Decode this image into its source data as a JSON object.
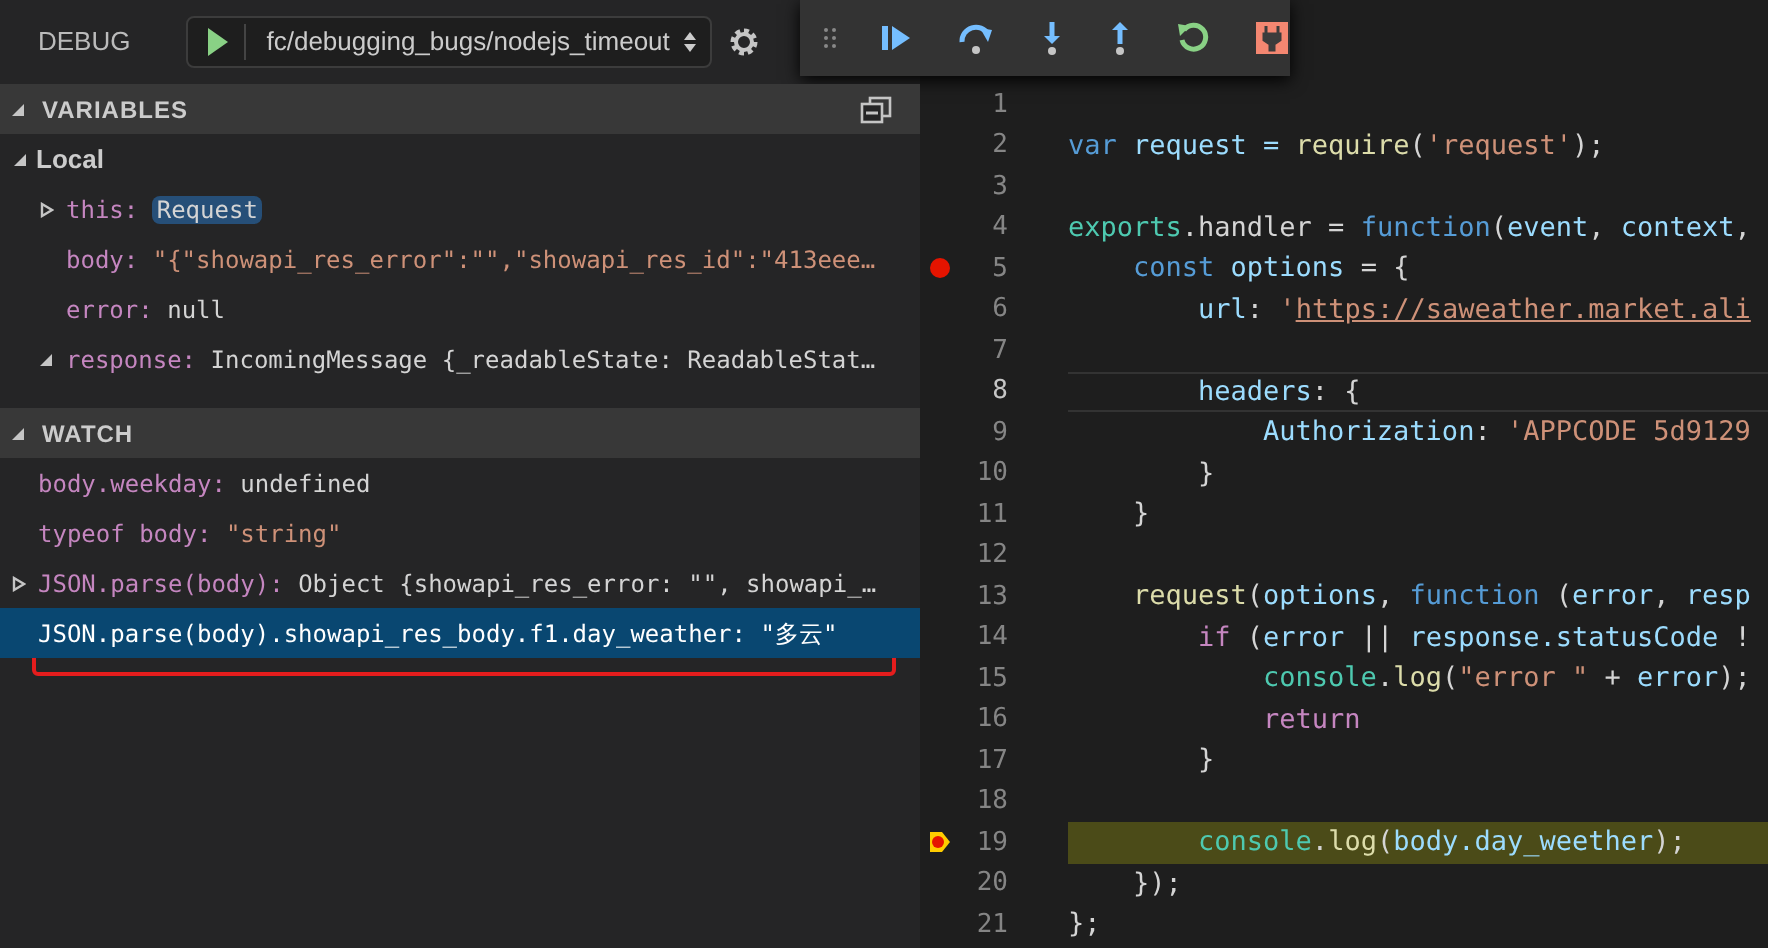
{
  "header": {
    "title": "DEBUG",
    "configuration": "fc/debugging_bugs/nodejs_timeout"
  },
  "toolbar": [
    {
      "kind": "continue"
    },
    {
      "kind": "step-over"
    },
    {
      "kind": "step-into"
    },
    {
      "kind": "step-out"
    },
    {
      "kind": "restart"
    },
    {
      "kind": "disconnect"
    }
  ],
  "variables": {
    "title": "VARIABLES",
    "expanded": true,
    "scopes": [
      {
        "name": "Local",
        "expanded": true,
        "children": [
          {
            "kind": "node",
            "expanded": false,
            "name": "this:",
            "value": {
              "text": "Request",
              "kind": "highlighted"
            }
          },
          {
            "kind": "leaf",
            "name": "body:",
            "value": {
              "text": "\"{\"showapi_res_error\":\"\",\"showapi_res_id\":\"413eee…",
              "kind": "string"
            }
          },
          {
            "kind": "leaf",
            "name": "error:",
            "value": {
              "text": "null",
              "kind": "plain"
            }
          },
          {
            "kind": "node",
            "expanded": true,
            "name": "response:",
            "value": {
              "text": "IncomingMessage {_readableState: ReadableStat…",
              "kind": "plain"
            }
          }
        ]
      }
    ]
  },
  "watch": {
    "title": "WATCH",
    "expanded": true,
    "items": [
      {
        "kind": "leaf",
        "expression": "body.weekday:",
        "value": {
          "text": "undefined",
          "kind": "plain"
        },
        "selected": false,
        "outlined": false
      },
      {
        "kind": "leaf",
        "expression": "typeof body:",
        "value": {
          "text": "\"string\"",
          "kind": "string"
        },
        "selected": false,
        "outlined": false
      },
      {
        "kind": "node",
        "expanded": false,
        "expression": "JSON.parse(body):",
        "value": {
          "text": "Object {showapi_res_error: \"\", showapi_…",
          "kind": "plain"
        },
        "selected": false,
        "outlined": false
      },
      {
        "kind": "leaf",
        "expression": "JSON.parse(body).showapi_res_body.f1.day_weather:",
        "value": {
          "text": "\"多云\"",
          "kind": "plain"
        },
        "selected": true,
        "outlined": true
      }
    ]
  },
  "editor": {
    "lines": [
      {
        "number": "1",
        "breakpoint": false,
        "paused": false,
        "focused": false
      },
      {
        "number": "2",
        "breakpoint": false,
        "paused": false,
        "focused": false,
        "tokens": [
          {
            "text": "var",
            "kind": "keyword"
          },
          {
            "text": " request = ",
            "kind": "variable"
          },
          {
            "text": "require",
            "kind": "function"
          },
          {
            "text": "(",
            "kind": "plain"
          },
          {
            "text": "'request'",
            "kind": "string"
          },
          {
            "text": ");",
            "kind": "plain"
          }
        ]
      },
      {
        "number": "3",
        "breakpoint": false,
        "paused": false,
        "focused": false
      },
      {
        "number": "4",
        "breakpoint": false,
        "paused": false,
        "focused": false,
        "tokens": [
          {
            "text": "exports",
            "kind": "type"
          },
          {
            "text": ".handler = ",
            "kind": "plain"
          },
          {
            "text": "function",
            "kind": "keyword"
          },
          {
            "text": "(",
            "kind": "plain"
          },
          {
            "text": "event",
            "kind": "variable"
          },
          {
            "text": ", ",
            "kind": "plain"
          },
          {
            "text": "context",
            "kind": "variable"
          },
          {
            "text": ",",
            "kind": "plain"
          }
        ]
      },
      {
        "number": "5",
        "breakpoint": true,
        "paused": false,
        "focused": false,
        "tokens": [
          {
            "text": "    const",
            "kind": "keyword"
          },
          {
            "text": " options",
            "kind": "variable"
          },
          {
            "text": " = {",
            "kind": "plain"
          }
        ]
      },
      {
        "number": "6",
        "breakpoint": false,
        "paused": false,
        "focused": false,
        "tokens": [
          {
            "text": "        url",
            "kind": "variable"
          },
          {
            "text": ": ",
            "kind": "plain"
          },
          {
            "text": "'",
            "kind": "string"
          },
          {
            "text": "https://saweather.market.ali",
            "kind": "link"
          }
        ]
      },
      {
        "number": "7",
        "breakpoint": false,
        "paused": false,
        "focused": false
      },
      {
        "number": "8",
        "breakpoint": false,
        "paused": false,
        "focused": true,
        "tokens": [
          {
            "text": "        headers",
            "kind": "variable"
          },
          {
            "text": ": {",
            "kind": "plain"
          }
        ]
      },
      {
        "number": "9",
        "breakpoint": false,
        "paused": false,
        "focused": false,
        "tokens": [
          {
            "text": "            Authorization",
            "kind": "variable"
          },
          {
            "text": ": ",
            "kind": "plain"
          },
          {
            "text": "'APPCODE 5d9129",
            "kind": "string"
          }
        ]
      },
      {
        "number": "10",
        "breakpoint": false,
        "paused": false,
        "focused": false,
        "tokens": [
          {
            "text": "        }",
            "kind": "plain"
          }
        ]
      },
      {
        "number": "11",
        "breakpoint": false,
        "paused": false,
        "focused": false,
        "tokens": [
          {
            "text": "    }",
            "kind": "plain"
          }
        ]
      },
      {
        "number": "12",
        "breakpoint": false,
        "paused": false,
        "focused": false
      },
      {
        "number": "13",
        "breakpoint": false,
        "paused": false,
        "focused": false,
        "tokens": [
          {
            "text": "    request",
            "kind": "function"
          },
          {
            "text": "(",
            "kind": "plain"
          },
          {
            "text": "options",
            "kind": "variable"
          },
          {
            "text": ", ",
            "kind": "plain"
          },
          {
            "text": "function",
            "kind": "keyword"
          },
          {
            "text": " (",
            "kind": "plain"
          },
          {
            "text": "error",
            "kind": "variable"
          },
          {
            "text": ", ",
            "kind": "plain"
          },
          {
            "text": "resp",
            "kind": "variable"
          }
        ]
      },
      {
        "number": "14",
        "breakpoint": false,
        "paused": false,
        "focused": false,
        "tokens": [
          {
            "text": "        if",
            "kind": "control"
          },
          {
            "text": " (",
            "kind": "plain"
          },
          {
            "text": "error",
            "kind": "variable"
          },
          {
            "text": " || ",
            "kind": "plain"
          },
          {
            "text": "response.statusCode",
            "kind": "variable"
          },
          {
            "text": " !",
            "kind": "plain"
          }
        ]
      },
      {
        "number": "15",
        "breakpoint": false,
        "paused": false,
        "focused": false,
        "tokens": [
          {
            "text": "            console",
            "kind": "type"
          },
          {
            "text": ".",
            "kind": "plain"
          },
          {
            "text": "log",
            "kind": "function"
          },
          {
            "text": "(",
            "kind": "plain"
          },
          {
            "text": "\"error \"",
            "kind": "string"
          },
          {
            "text": " + ",
            "kind": "plain"
          },
          {
            "text": "error",
            "kind": "variable"
          },
          {
            "text": ");",
            "kind": "plain"
          }
        ]
      },
      {
        "number": "16",
        "breakpoint": false,
        "paused": false,
        "focused": false,
        "tokens": [
          {
            "text": "            return",
            "kind": "control"
          }
        ]
      },
      {
        "number": "17",
        "breakpoint": false,
        "paused": false,
        "focused": false,
        "tokens": [
          {
            "text": "        }",
            "kind": "plain"
          }
        ]
      },
      {
        "number": "18",
        "breakpoint": false,
        "paused": false,
        "focused": false
      },
      {
        "number": "19",
        "breakpoint": true,
        "paused": true,
        "focused": false,
        "tokens": [
          {
            "text": "        console",
            "kind": "type"
          },
          {
            "text": ".",
            "kind": "plain"
          },
          {
            "text": "log",
            "kind": "function"
          },
          {
            "text": "(",
            "kind": "plain"
          },
          {
            "text": "body.day_weether",
            "kind": "variable"
          },
          {
            "text": ");",
            "kind": "plain"
          }
        ]
      },
      {
        "number": "20",
        "breakpoint": false,
        "paused": false,
        "focused": false,
        "tokens": [
          {
            "text": "    });",
            "kind": "plain"
          }
        ]
      },
      {
        "number": "21",
        "breakpoint": false,
        "paused": false,
        "focused": false,
        "tokens": [
          {
            "text": "};",
            "kind": "plain"
          }
        ]
      }
    ]
  }
}
